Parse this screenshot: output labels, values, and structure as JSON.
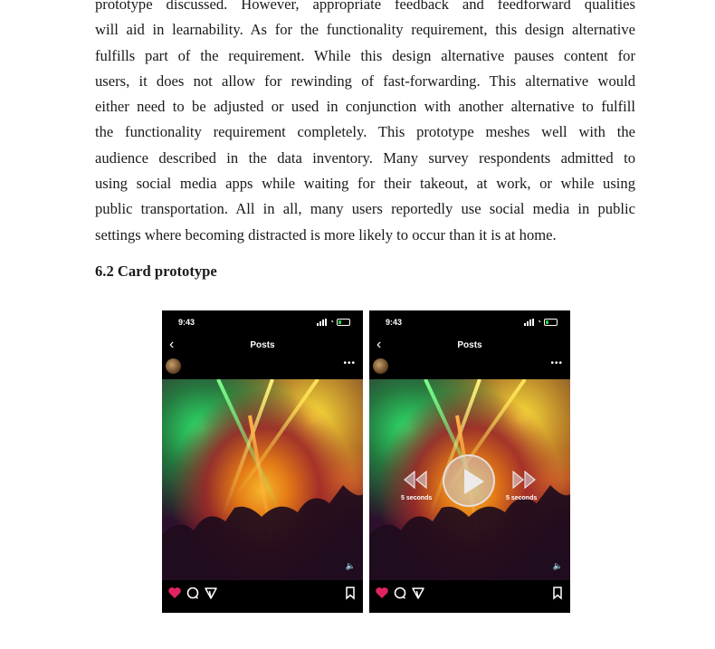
{
  "paragraph_lines": [
    "prototype discussed. However, appropriate feedback and feedforward qualities",
    "will aid in learnability. As for the functionality requirement, this design alternative",
    "fulfills part of the requirement. While this design alternative pauses content for",
    "users, it does not allow for rewinding of fast-forwarding. This alternative would",
    "either need to be adjusted or used in conjunction with another alternative to fulfill",
    "the functionality requirement completely. This prototype meshes well with the",
    "audience described in the data inventory. Many survey respondents admitted to",
    "using social media apps while waiting for their takeout, at work, or while using",
    "public transportation. All in all, many users reportedly use social media in public",
    "settings where becoming distracted is more likely to occur than it is at home."
  ],
  "section_heading": "6.2 Card prototype",
  "phones": [
    {
      "time": "9:43",
      "title": "Posts",
      "back": "‹",
      "more": "•••"
    },
    {
      "time": "9:43",
      "title": "Posts",
      "back": "‹",
      "more": "•••",
      "rewind_label": "5 seconds",
      "forward_label": "5 seconds"
    }
  ],
  "icons": {
    "back": "chevron-left-icon",
    "more": "more-icon",
    "like": "heart-icon",
    "comment": "comment-icon",
    "share": "send-icon",
    "save": "bookmark-icon",
    "volume": "volume-icon",
    "play": "play-icon",
    "rewind": "rewind-icon",
    "forward": "fast-forward-icon"
  },
  "colors": {
    "like": "#e0245e",
    "screen_bg": "#000000"
  }
}
